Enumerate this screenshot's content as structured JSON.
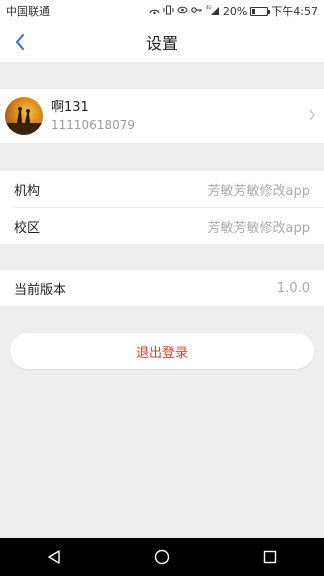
{
  "status_bar": {
    "carrier": "中国联通",
    "network": "4G",
    "battery_percent": "20%",
    "time": "下午4:57"
  },
  "header": {
    "title": "设置",
    "back_icon": "chevron-left-icon"
  },
  "profile": {
    "name": "啊131",
    "phone": "11110618079",
    "chevron_icon": "chevron-right-icon"
  },
  "settings": {
    "institution": {
      "label": "机构",
      "value": "芳敏芳敏修改app"
    },
    "campus": {
      "label": "校区",
      "value": "芳敏芳敏修改app"
    },
    "version": {
      "label": "当前版本",
      "value": "1.0.0"
    }
  },
  "logout": {
    "label": "退出登录"
  },
  "colors": {
    "accent_blue": "#2c6fd6",
    "logout_red": "#e23b2e",
    "background": "#eeeeee"
  },
  "system_nav": {
    "back_icon": "triangle-back-icon",
    "home_icon": "circle-home-icon",
    "recents_icon": "square-recents-icon"
  }
}
